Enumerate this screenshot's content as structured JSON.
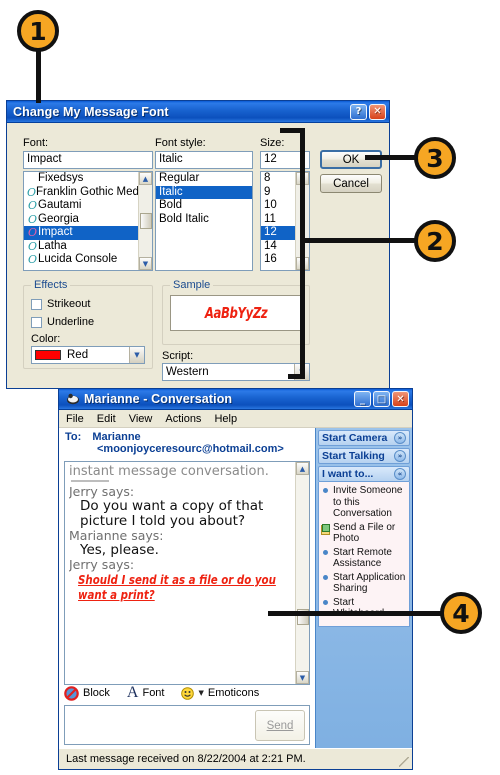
{
  "callouts": [
    {
      "n": "1"
    },
    {
      "n": "2"
    },
    {
      "n": "3"
    },
    {
      "n": "4"
    }
  ],
  "font_dialog": {
    "title": "Change My Message Font",
    "help_btn": "?",
    "close_btn": "✕",
    "font_label": "Font:",
    "font_value": "Impact",
    "font_list": [
      {
        "name": "Fixedsys",
        "icon": "",
        "selected": false
      },
      {
        "name": "Franklin Gothic Medium",
        "icon": "O",
        "selected": false
      },
      {
        "name": "Gautami",
        "icon": "O",
        "selected": false
      },
      {
        "name": "Georgia",
        "icon": "O",
        "selected": false
      },
      {
        "name": "Impact",
        "icon": "O",
        "selected": true
      },
      {
        "name": "Latha",
        "icon": "O",
        "selected": false
      },
      {
        "name": "Lucida Console",
        "icon": "O",
        "selected": false
      }
    ],
    "style_label": "Font style:",
    "style_value": "Italic",
    "style_list": [
      {
        "name": "Regular",
        "selected": false
      },
      {
        "name": "Italic",
        "selected": true
      },
      {
        "name": "Bold",
        "selected": false
      },
      {
        "name": "Bold Italic",
        "selected": false
      }
    ],
    "size_label": "Size:",
    "size_value": "12",
    "size_list": [
      {
        "name": "8",
        "selected": false
      },
      {
        "name": "9",
        "selected": false
      },
      {
        "name": "10",
        "selected": false
      },
      {
        "name": "11",
        "selected": false
      },
      {
        "name": "12",
        "selected": true
      },
      {
        "name": "14",
        "selected": false
      },
      {
        "name": "16",
        "selected": false
      }
    ],
    "ok_label": "OK",
    "cancel_label": "Cancel",
    "effects_label": "Effects",
    "strikeout_label": "Strikeout",
    "underline_label": "Underline",
    "color_label": "Color:",
    "color_value": "Red",
    "color_hex": "#FF0000",
    "sample_label": "Sample",
    "sample_text": "AaBbYyZz",
    "script_label": "Script:",
    "script_value": "Western"
  },
  "conversation": {
    "title": "Marianne - Conversation",
    "min_btn": "_",
    "max_btn": "□",
    "close_btn": "✕",
    "menu": [
      "File",
      "Edit",
      "View",
      "Actions",
      "Help"
    ],
    "to_label": "To:",
    "to_name": "Marianne",
    "to_email": "<moonjoyceresourc@hotmail.com>",
    "transcript_intro": "instant message conversation.",
    "messages": [
      {
        "who": "Jerry says:",
        "lines": [
          "Do you want a copy of that",
          "picture I told you about?"
        ],
        "style": "plain"
      },
      {
        "who": "Marianne says:",
        "lines": [
          "Yes, please."
        ],
        "style": "plain"
      },
      {
        "who": "Jerry says:",
        "lines": [
          "Should I send it as a file or do you",
          "want a print?"
        ],
        "style": "red-impact"
      }
    ],
    "format_bar": [
      {
        "label": "Block",
        "icon": "block-icon"
      },
      {
        "label": "Font",
        "icon": "font-icon"
      },
      {
        "label": "Emoticons",
        "icon": "smiley-icon"
      }
    ],
    "input_value": "",
    "send_label": "Send",
    "panels": [
      {
        "title": "Start Camera",
        "state": "collapsed",
        "chevron": "»",
        "items": []
      },
      {
        "title": "Start Talking",
        "state": "collapsed",
        "chevron": "»",
        "items": []
      },
      {
        "title": "I want to...",
        "state": "expanded",
        "chevron": "«",
        "items": [
          {
            "label": "Invite Someone to this Conversation",
            "icon": "bullet"
          },
          {
            "label": "Send a File or Photo",
            "icon": "file-photo-icon"
          },
          {
            "label": "Start Remote Assistance",
            "icon": "bullet"
          },
          {
            "label": "Start Application Sharing",
            "icon": "bullet"
          },
          {
            "label": "Start Whiteboard",
            "icon": "bullet"
          }
        ]
      }
    ],
    "status_text": "Last message received on 8/22/2004 at 2:21 PM."
  }
}
